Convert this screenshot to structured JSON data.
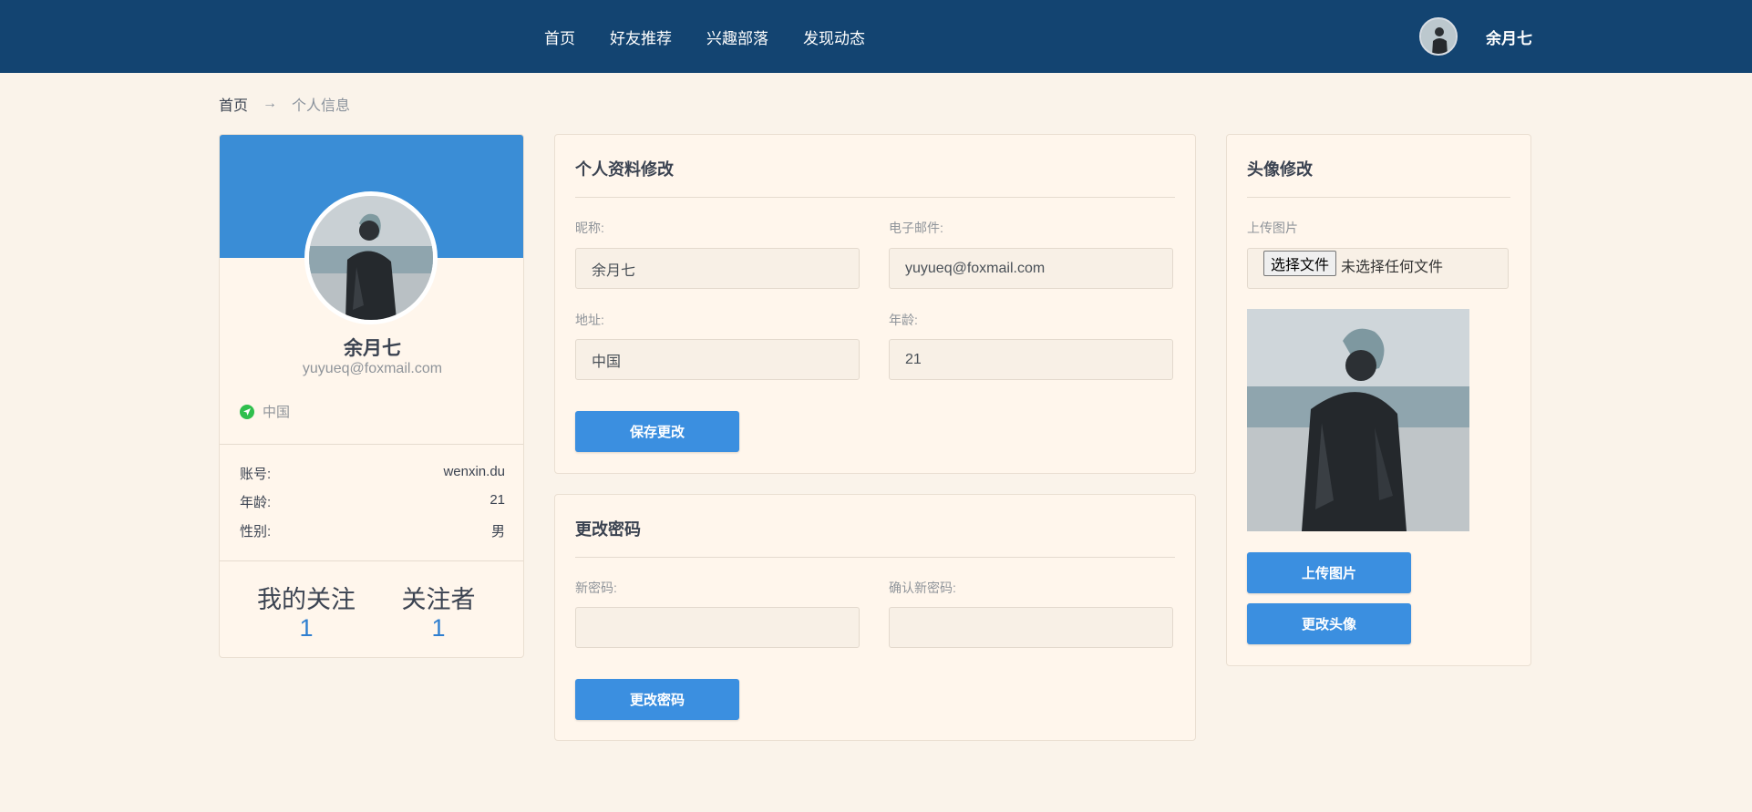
{
  "nav": {
    "links": [
      "首页",
      "好友推荐",
      "兴趣部落",
      "发现动态"
    ],
    "username": "余月七"
  },
  "breadcrumb": {
    "home": "首页",
    "separator": "→",
    "current": "个人信息"
  },
  "profile_card": {
    "name": "余月七",
    "email": "yuyueq@foxmail.com",
    "location": "中国",
    "rows": [
      {
        "label": "账号:",
        "value": "wenxin.du"
      },
      {
        "label": "年龄:",
        "value": "21"
      },
      {
        "label": "性别:",
        "value": "男"
      }
    ],
    "following": {
      "label": "我的关注",
      "count": "1"
    },
    "followers": {
      "label": "关注者",
      "count": "1"
    }
  },
  "edit_profile": {
    "title": "个人资料修改",
    "nickname_label": "昵称:",
    "nickname_value": "余月七",
    "email_label": "电子邮件:",
    "email_value": "yuyueq@foxmail.com",
    "address_label": "地址:",
    "address_value": "中国",
    "age_label": "年龄:",
    "age_value": "21",
    "save_button": "保存更改"
  },
  "change_password": {
    "title": "更改密码",
    "new_label": "新密码:",
    "confirm_label": "确认新密码:",
    "new_value": "",
    "confirm_value": "",
    "submit_button": "更改密码"
  },
  "avatar_edit": {
    "title": "头像修改",
    "upload_label": "上传图片",
    "file_button": "选择文件",
    "file_status": "未选择任何文件",
    "upload_button": "上传图片",
    "change_button": "更改头像"
  },
  "colors": {
    "topbar": "#134471",
    "page_bg": "#faf3ea",
    "banner": "#3a8dd6",
    "primary_button": "#3b8fe0",
    "location_dot": "#2fbf4d",
    "follow_count": "#2f7fd0"
  }
}
